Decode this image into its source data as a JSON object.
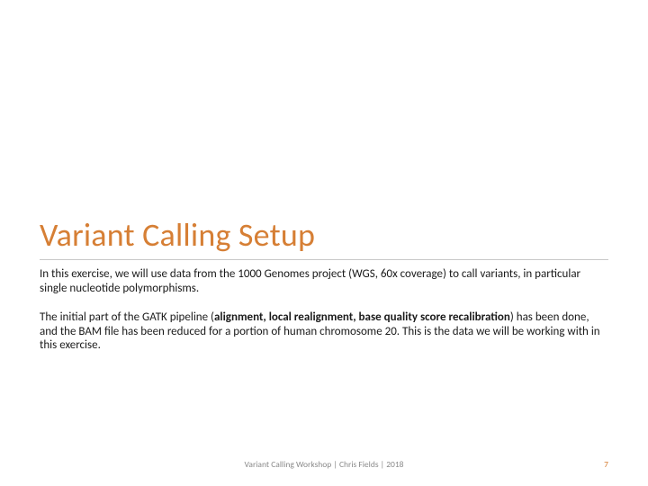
{
  "title": "Variant Calling Setup",
  "paragraphs": {
    "p1": "In this exercise, we will use data from the 1000 Genomes project (WGS, 60x coverage) to call variants, in particular single nucleotide polymorphisms.",
    "p2_a": "The initial part of the GATK pipeline (",
    "p2_bold": "alignment, local realignment, base quality score recalibration",
    "p2_b": ") has been done, and the BAM file has been reduced for a portion of human chromosome 20. This is the data we will be working with in this exercise."
  },
  "footer": {
    "text": "Variant Calling Workshop | Chris Fields | 2018",
    "page": "7"
  }
}
